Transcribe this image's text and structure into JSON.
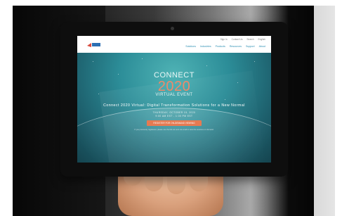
{
  "photo": {
    "website": {
      "logo": "",
      "utility_nav": [
        "Sign In",
        "Contact Us",
        "Search",
        "English"
      ],
      "main_nav": [
        "Solutions",
        "Industries",
        "Products",
        "Resources",
        "Support",
        "About"
      ],
      "hero": {
        "title": "CONNECT",
        "year": "2020",
        "subtitle": "VIRTUAL EVENT",
        "tagline": "Connect 2020 Virtual: Digital Transformation Solutions for a New Normal",
        "date": "THURSDAY, OCTOBER 15, 2020",
        "time": "9:00 AM EST - 1:00 PM EST",
        "cta": "REGISTER FOR ON-DEMAND VIEWING",
        "note": "If you previously registered, please use the link we sent via email to view the sessions on demand."
      }
    },
    "colors": {
      "accent": "#e57a52",
      "nav": "#2b8fb3",
      "hero": "#2c8d98"
    }
  }
}
